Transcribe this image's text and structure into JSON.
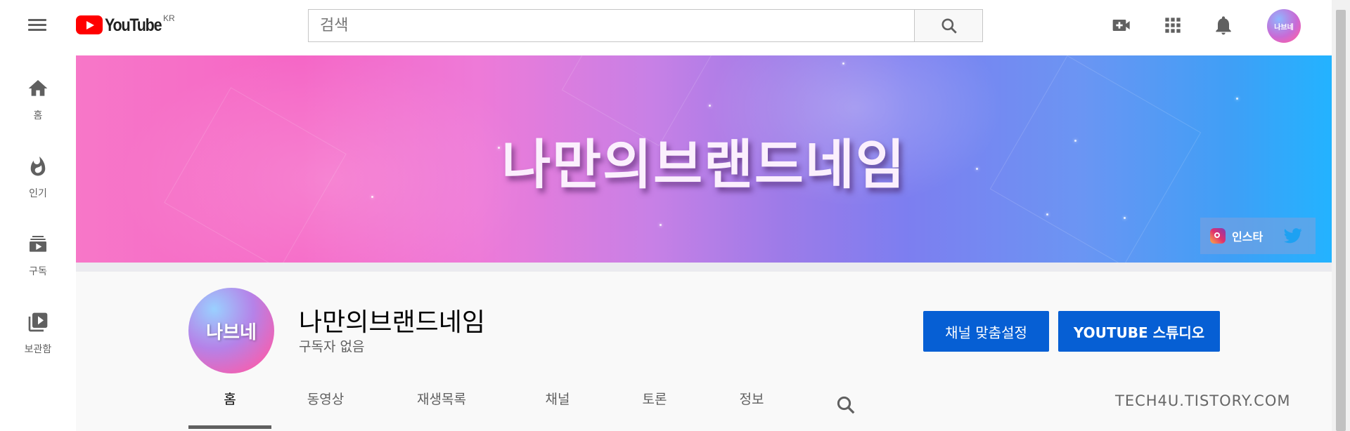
{
  "header": {
    "logo_text": "YouTube",
    "region": "KR",
    "search_placeholder": "검색"
  },
  "guide": {
    "items": [
      {
        "label": "홈",
        "icon": "home-icon"
      },
      {
        "label": "인기",
        "icon": "fire-icon"
      },
      {
        "label": "구독",
        "icon": "subscriptions-icon"
      },
      {
        "label": "보관함",
        "icon": "library-icon"
      }
    ]
  },
  "banner": {
    "title": "나만의브랜드네임",
    "link_label": "인스타"
  },
  "channel": {
    "avatar_text": "나브네",
    "top_avatar_text": "나브네",
    "name": "나만의브랜드네임",
    "subscribers": "구독자 없음",
    "customize_label": "채널 맞춤설정",
    "studio_label": "YOUTUBE 스튜디오"
  },
  "tabs": [
    {
      "label": "홈",
      "active": true
    },
    {
      "label": "동영상",
      "active": false
    },
    {
      "label": "재생목록",
      "active": false
    },
    {
      "label": "채널",
      "active": false
    },
    {
      "label": "토론",
      "active": false
    },
    {
      "label": "정보",
      "active": false
    }
  ],
  "watermark": "TECH4U.TISTORY.COM",
  "colors": {
    "brand_red": "#ff0000",
    "button_blue": "#065fd4"
  }
}
